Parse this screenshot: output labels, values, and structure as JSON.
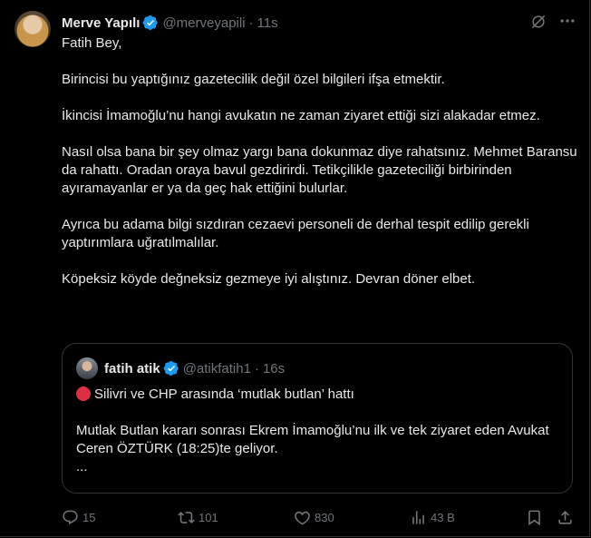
{
  "tweet": {
    "author_name": "Merve Yapılı",
    "handle": "@merveyapili",
    "separator": "·",
    "time": "11s",
    "paragraphs": [
      "Fatih Bey,",
      "Birincisi bu yaptığınız gazetecilik değil özel bilgileri ifşa etmektir.",
      "İkincisi İmamoğlu’nu hangi avukatın ne zaman ziyaret ettiği sizi alakadar etmez.",
      "Nasıl olsa bana bir şey olmaz yargı bana dokunmaz diye rahatsınız. Mehmet Baransu da rahattı. Oradan oraya bavul gezdirirdi. Tetikçilikle gazeteciliği birbirinden ayıramayanlar er ya da geç hak ettiğini bulurlar.",
      "Ayrıca bu adama bilgi sızdıran cezaevi personeli de derhal tespit edilip gerekli yaptırımlara uğratılmalılar.",
      "Köpeksiz köyde değneksiz gezmeye iyi alıştınız. Devran döner elbet."
    ]
  },
  "quote": {
    "author_name": "fatih atik",
    "handle": "@atikfatih1",
    "separator": "·",
    "time": "16s",
    "line1": "Silivri ve CHP arasında ‘mutlak butlan’ hattı",
    "line2": "Mutlak Butlan kararı sonrası Ekrem İmamoğlu’nu ilk ve tek ziyaret eden Avukat Ceren ÖZTÜRK (18:25)te geliyor.",
    "line3": "..."
  },
  "actions": {
    "replies": "15",
    "reposts": "101",
    "likes": "830",
    "views": "43 B"
  },
  "colors": {
    "background": "#000000",
    "text": "#e7e9ea",
    "muted": "#71767b",
    "verified": "#1d9bf0",
    "border": "#2f3336",
    "red_circle": "#dd2e44"
  },
  "icons": [
    "verified-badge-icon",
    "grok-icon",
    "more-icon",
    "reply-icon",
    "repost-icon",
    "like-icon",
    "views-icon",
    "bookmark-icon",
    "share-icon"
  ]
}
